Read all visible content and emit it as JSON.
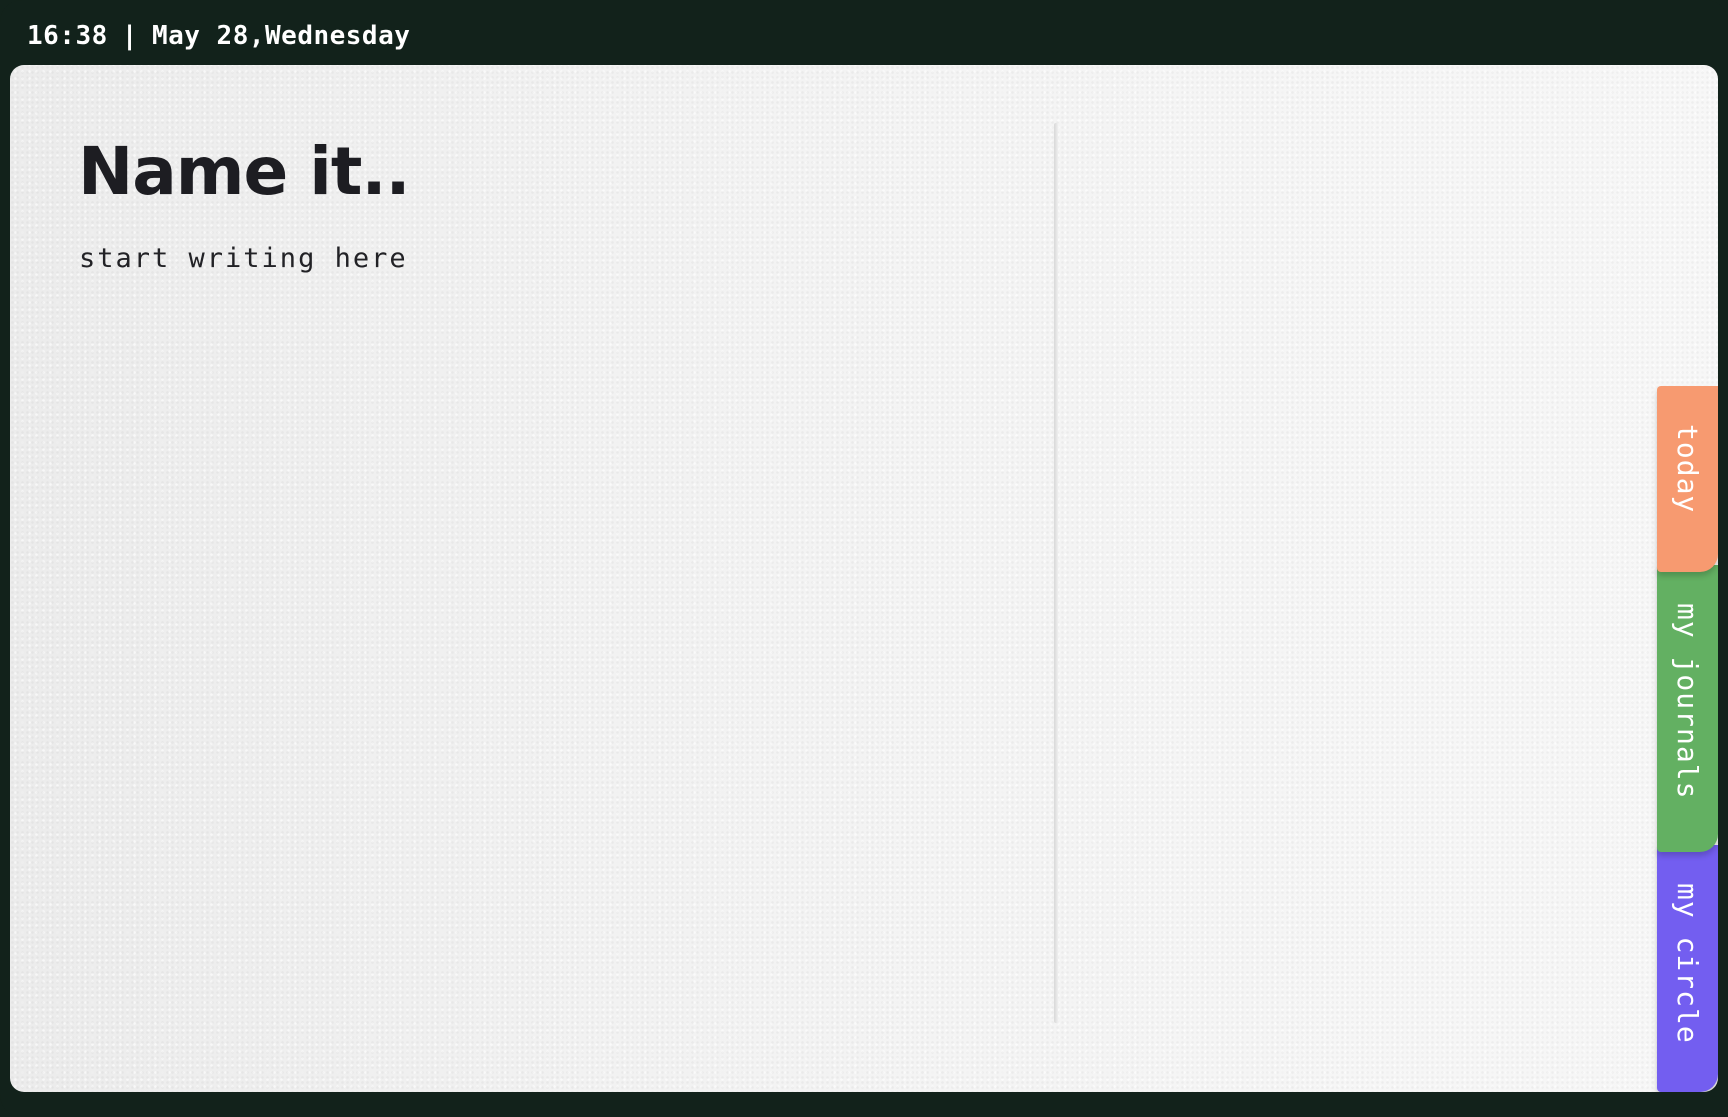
{
  "status_bar": {
    "time": "16:38",
    "separator": "|",
    "date": "May 28,Wednesday"
  },
  "editor": {
    "title_placeholder": "Name it..",
    "body_placeholder": "start writing here"
  },
  "tabs": [
    {
      "label": "today",
      "color": "#f79a70"
    },
    {
      "label": "my journals",
      "color": "#63b062"
    },
    {
      "label": "my circle",
      "color": "#735ef0"
    }
  ],
  "colors": {
    "frame": "#12221b",
    "page": "#f3f3f3",
    "title_text": "#1d1d22"
  }
}
